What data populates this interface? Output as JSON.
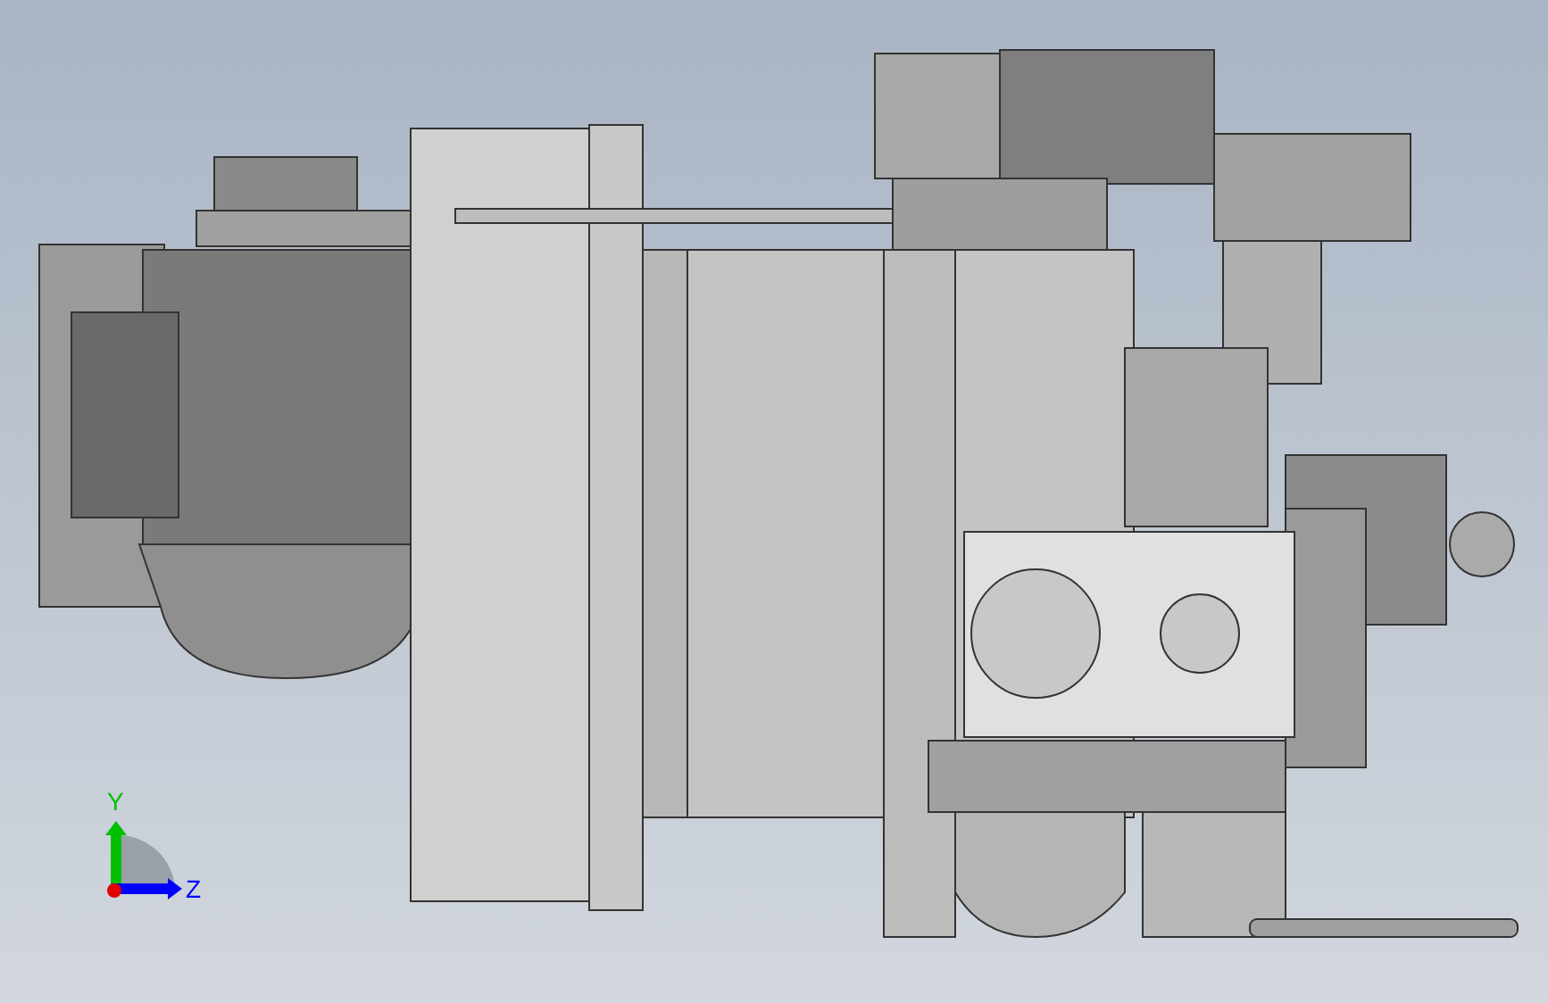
{
  "viewport": {
    "triad": {
      "axes": [
        {
          "label": "Y",
          "kind": "vertical",
          "color": "#00c000"
        },
        {
          "label": "Z",
          "kind": "horizontal",
          "color": "#0000ff"
        }
      ]
    }
  }
}
